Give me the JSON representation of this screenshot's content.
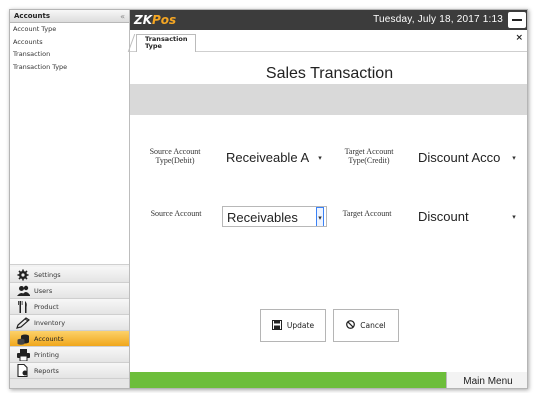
{
  "sidebar": {
    "header": "Accounts",
    "collapse_icon": "chevron-double-left-icon",
    "sub_items": [
      {
        "label": "Account Type"
      },
      {
        "label": "Accounts"
      },
      {
        "label": "Transaction"
      },
      {
        "label": "Transaction Type"
      }
    ],
    "nav": [
      {
        "label": "Settings",
        "icon": "gear-icon"
      },
      {
        "label": "Users",
        "icon": "users-icon"
      },
      {
        "label": "Product",
        "icon": "fork-knife-icon"
      },
      {
        "label": "Inventory",
        "icon": "pencil-icon"
      },
      {
        "label": "Accounts",
        "icon": "coins-icon",
        "active": true
      },
      {
        "label": "Printing",
        "icon": "printer-icon"
      },
      {
        "label": "Reports",
        "icon": "report-icon"
      }
    ]
  },
  "titlebar": {
    "logo_zk": "ZK",
    "logo_pos": "Pos",
    "datetime": "Tuesday, July 18, 2017 1:13"
  },
  "tab": {
    "label": "Transaction Type",
    "close": "×"
  },
  "form": {
    "title": "Sales Transaction",
    "source_type_label": "Source Account Type(Debit)",
    "source_type_value": "Receiveable A",
    "target_type_label": "Target Account Type(Credit)",
    "target_type_value": "Discount Acco",
    "source_account_label": "Source Account",
    "source_account_value": "Receivables",
    "target_account_label": "Target Account",
    "target_account_value": "Discount"
  },
  "buttons": {
    "update": "Update",
    "cancel": "Cancel"
  },
  "statusbar": {
    "main_menu": "Main Menu",
    "color": "#6dbe3b"
  },
  "colors": {
    "active_nav": "#f0a71c",
    "titlebar": "#3c3c3c",
    "logo_accent": "#f5a623"
  }
}
